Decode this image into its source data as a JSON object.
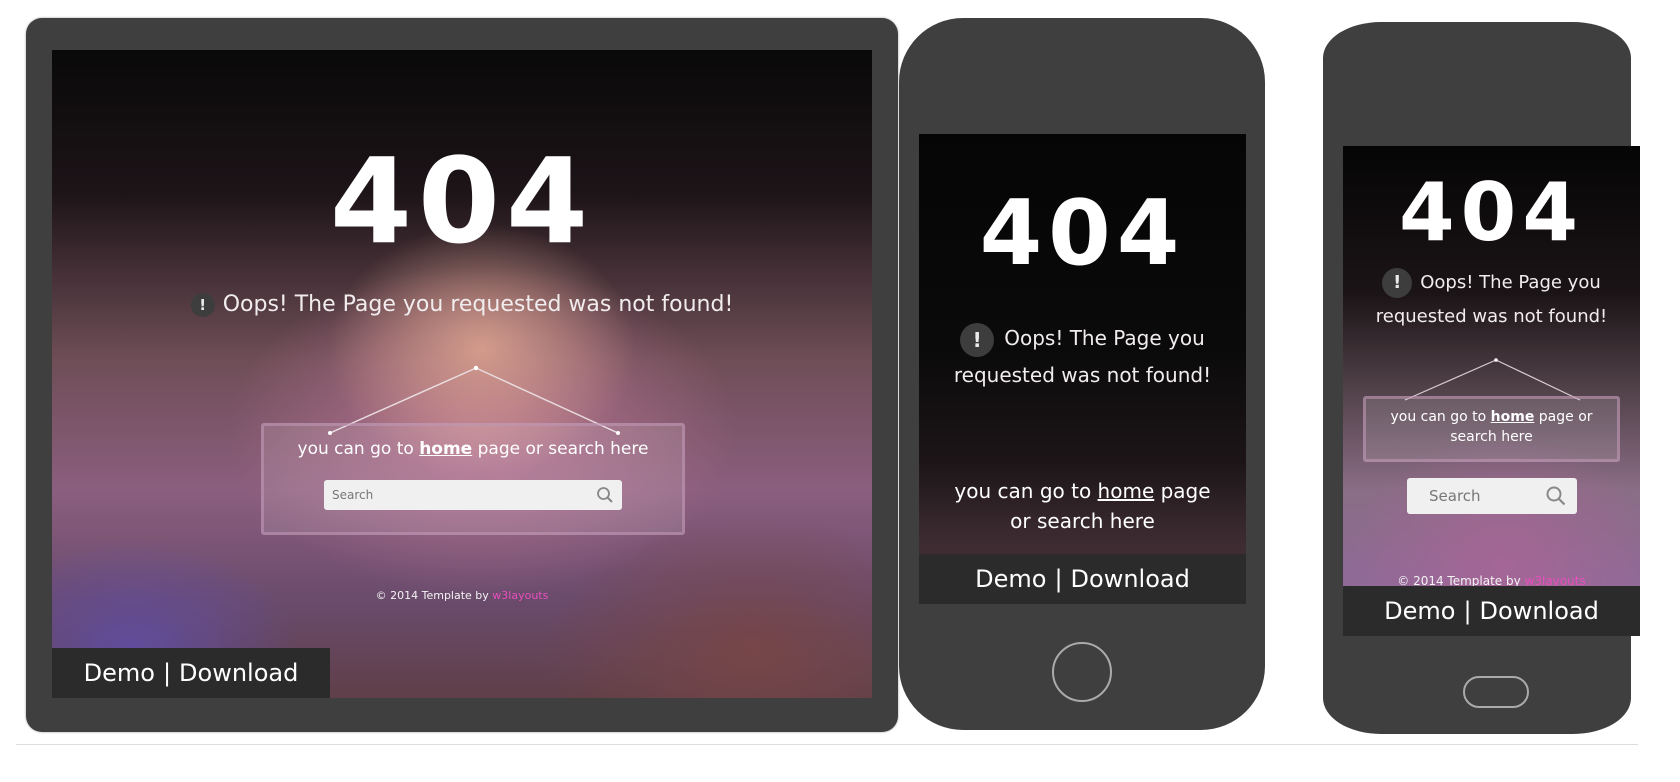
{
  "heading": "404",
  "message": "Oops! The Page you requested was not found!",
  "warning_glyph": "!",
  "go_prefix": "you can go  to",
  "home_link": "home",
  "go_suffix": "page or search here",
  "search_placeholder": "Search",
  "credit_prefix": "© 2014 Template by",
  "credit_brand": "w3layouts",
  "demo_label": "Demo",
  "divider": "|",
  "download_label": "Download",
  "colors": {
    "device_body": "#3f3f3f",
    "bar": "#2b2b2b",
    "brand_pink": "#e84fbd"
  },
  "icons": [
    "warning-icon",
    "search-icon",
    "home-button-icon"
  ]
}
